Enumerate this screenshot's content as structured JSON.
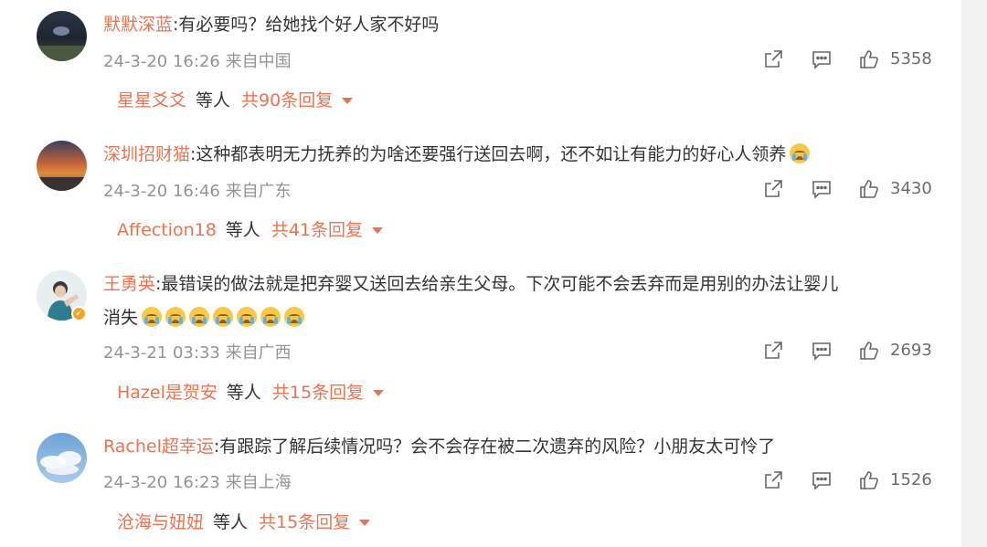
{
  "comments": [
    {
      "username": "默默深蓝",
      "text": "有必要吗？给她找个好人家不好吗",
      "text_line2": "",
      "emoji_count": 0,
      "time": "24-3-20 16:26",
      "location": "来自中国",
      "likes": "5358",
      "reply_user": "星星爻爻",
      "reply_mid": "等人",
      "reply_total": "共90条回复",
      "verified": false
    },
    {
      "username": "深圳招财猫",
      "text": "这种都表明无力抚养的为啥还要强行送回去啊，还不如让有能力的好心人领养",
      "text_line2": "",
      "emoji_count": 1,
      "time": "24-3-20 16:46",
      "location": "来自广东",
      "likes": "3430",
      "reply_user": "Affection18",
      "reply_mid": "等人",
      "reply_total": "共41条回复",
      "verified": false
    },
    {
      "username": "王勇英",
      "text": "最错误的做法就是把弃婴又送回去给亲生父母。下次可能不会丢弃而是用别的办法让婴儿",
      "text_line2": "消失",
      "emoji_count": 7,
      "time": "24-3-21 03:33",
      "location": "来自广西",
      "likes": "2693",
      "reply_user": "Hazel是贺安",
      "reply_mid": "等人",
      "reply_total": "共15条回复",
      "verified": true
    },
    {
      "username": "Rachel超幸运",
      "text": "有跟踪了解后续情况吗？会不会存在被二次遗弃的风险？小朋友太可怜了",
      "text_line2": "",
      "emoji_count": 0,
      "time": "24-3-20 16:23",
      "location": "来自上海",
      "likes": "1526",
      "reply_user": "沧海与妞妞",
      "reply_mid": "等人",
      "reply_total": "共15条回复",
      "verified": false
    }
  ],
  "colors": {
    "username": "#eb7350",
    "text": "#333333",
    "meta": "#939393",
    "page_bg": "#f2f2f2",
    "panel_bg": "#ffffff"
  },
  "icons": [
    "share-icon",
    "comment-icon",
    "like-icon",
    "chevron-down-icon",
    "crying-emoji-icon",
    "verified-badge-icon"
  ]
}
